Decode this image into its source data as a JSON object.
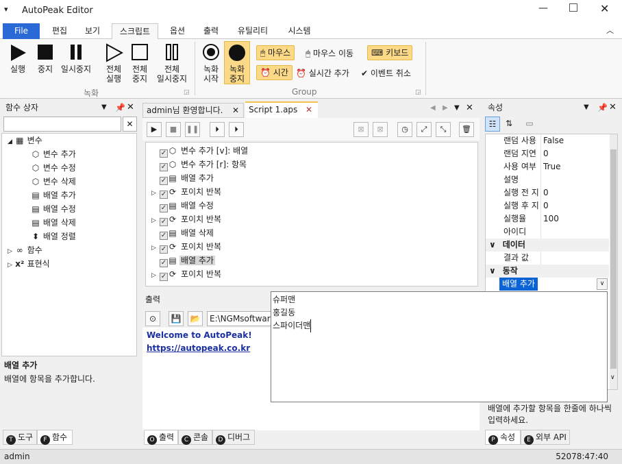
{
  "app": {
    "title": "AutoPeak Editor",
    "menu_icon": "menu-icon"
  },
  "menu": {
    "tabs": [
      "File",
      "편집",
      "보기",
      "스크립트",
      "옵션",
      "출력",
      "유틸리티",
      "시스템"
    ]
  },
  "ribbon": {
    "rec_group": {
      "run": "실행",
      "stop": "중지",
      "pause": "일시중지",
      "all_run_1": "전체",
      "all_run_2": "실행",
      "all_stop_1": "전체",
      "all_stop_2": "중지",
      "all_pause_1": "전체",
      "all_pause_2": "일시중지",
      "label": "녹화"
    },
    "group": {
      "rec_start_1": "녹화",
      "rec_start_2": "시작",
      "rec_stop_1": "녹화",
      "rec_stop_2": "중지",
      "mouse": "마우스",
      "mouse_move": "마우스 이동",
      "keyboard": "키보드",
      "time": "시간",
      "realtime_add": "실시간 추가",
      "event_cancel": "이벤트 취소",
      "label": "Group"
    }
  },
  "left_panel": {
    "title": "함수 상자",
    "search_value": "",
    "tree": {
      "variables": "변수",
      "var_items": [
        "변수 추가",
        "변수 수정",
        "변수 삭제",
        "배열 추가",
        "배열 수정",
        "배열 삭제",
        "배열 정렬"
      ],
      "functions": "함수",
      "expressions": "표현식"
    },
    "desc_title": "배열 추가",
    "desc_text": "배열에 항목을 추가합니다.",
    "tabs": [
      "도구",
      "함수"
    ]
  },
  "doc_tabs": {
    "welcome": "admin님 환영합니다.",
    "script": "Script 1.aps"
  },
  "script_lines": [
    {
      "text": "변수 추가 [v]: 배열",
      "expand": false
    },
    {
      "text": "변수 추가 [r]: 항목",
      "expand": false
    },
    {
      "text": "배열 추가",
      "expand": false
    },
    {
      "text": "포이치 반복",
      "expand": true
    },
    {
      "text": "배열 수정",
      "expand": false
    },
    {
      "text": "포이치 반복",
      "expand": true
    },
    {
      "text": "배열 삭제",
      "expand": false
    },
    {
      "text": "포이치 반복",
      "expand": true
    },
    {
      "text": "배열 추가",
      "expand": false,
      "selected": true
    },
    {
      "text": "포이치 반복",
      "expand": true
    }
  ],
  "output": {
    "title": "출력",
    "path": "E:\\NGMsoftware",
    "welcome": "Welcome to AutoPeak!",
    "link": "https://autopeak.co.kr",
    "tabs": [
      "출력",
      "콘솔",
      "디버그"
    ]
  },
  "popup_editor": {
    "lines": [
      "슈퍼맨",
      "홍길동",
      "스파이더맨"
    ]
  },
  "props": {
    "title": "속성",
    "rows": [
      {
        "name": "랜덤 사용",
        "value": "False"
      },
      {
        "name": "랜덤 지연",
        "value": "0"
      },
      {
        "name": "사용 여부",
        "value": "True"
      },
      {
        "name": "설명",
        "value": ""
      },
      {
        "name": "실행 전 지",
        "value": "0"
      },
      {
        "name": "실행 후 지",
        "value": "0"
      },
      {
        "name": "실행율",
        "value": "100"
      },
      {
        "name": "아이디",
        "value": ""
      }
    ],
    "cat_data": "데이터",
    "data_rows": [
      {
        "name": "결과 값",
        "value": ""
      }
    ],
    "cat_action": "동작",
    "action_value": "배열 추가",
    "desc": "배열에 추가할 항목을 한줄에 하나씩 입력하세요.",
    "tabs": [
      "속성",
      "외부 API"
    ]
  },
  "status": {
    "user": "admin",
    "time": "52078:47:40"
  }
}
